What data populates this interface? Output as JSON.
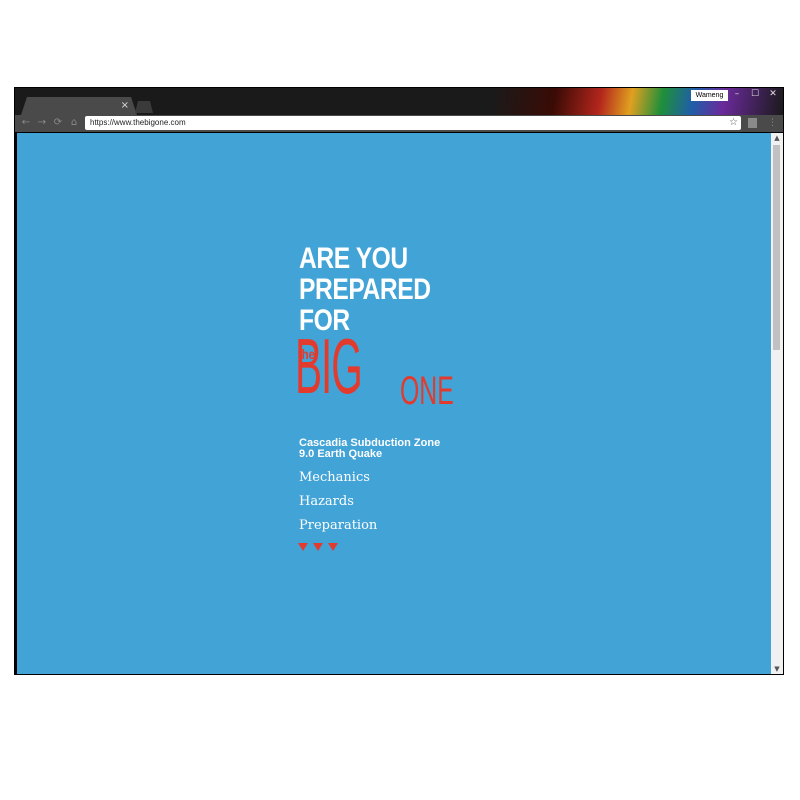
{
  "browser": {
    "tab_close": "×",
    "profile_name": "Wameng",
    "window_controls": {
      "minimize": "–",
      "maximize": "☐",
      "close": "✕"
    },
    "nav": {
      "back": "←",
      "forward": "→",
      "reload": "⟳",
      "home": "⌂"
    },
    "url": "https://www.thebigone.com",
    "bookmark": "☆",
    "menu": "⋮",
    "scroll_up": "▲",
    "scroll_down": "▼"
  },
  "page": {
    "headline_lines": [
      "ARE YOU",
      "PREPARED",
      "FOR"
    ],
    "logo_the": "the",
    "logo_big": "BIG",
    "logo_one": "ONE",
    "subtitle_line1": "Cascadia Subduction Zone",
    "subtitle_line2": "9.0 Earth Quake",
    "nav_links": [
      "Mechanics",
      "Hazards",
      "Preparation"
    ],
    "arrow_count": 3
  },
  "colors": {
    "page_background": "#42a3d7",
    "accent_red": "#e23b2e",
    "text_white": "#ffffff"
  }
}
